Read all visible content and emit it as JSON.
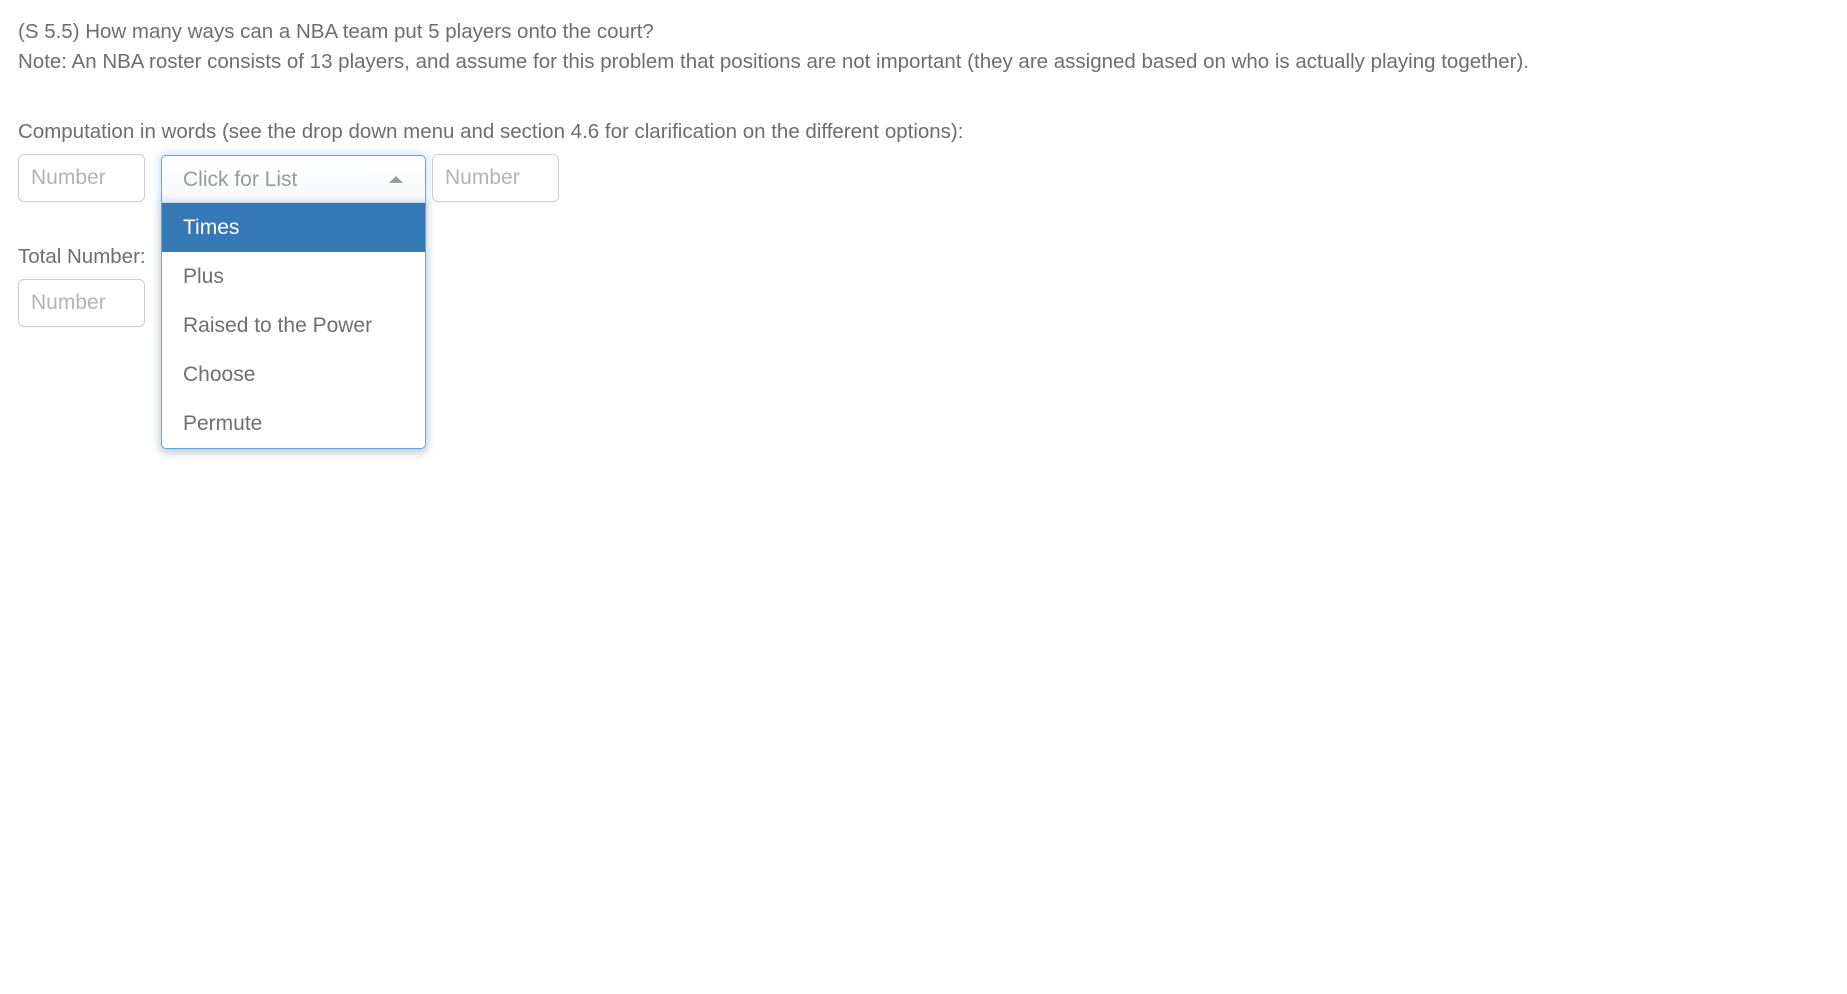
{
  "question": {
    "line1": "(S 5.5) How many ways can a NBA team put 5 players onto the court?",
    "line2": "Note: An NBA roster consists of 13 players, and assume for this problem that positions are not important (they are assigned based on who is actually playing together)."
  },
  "prompt": {
    "text": "Computation in words (see the drop down menu and section 4.6 for clarification on the different options):"
  },
  "inputs": {
    "left": {
      "value": "",
      "placeholder": "Number"
    },
    "right": {
      "value": "",
      "placeholder": "Number"
    },
    "total": {
      "value": "",
      "placeholder": "Number"
    }
  },
  "dropdown": {
    "selected_label": "Click for List",
    "caret_icon": "caret-up-icon",
    "expanded": true,
    "highlighted_index": 0,
    "options": [
      {
        "label": "Times"
      },
      {
        "label": "Plus"
      },
      {
        "label": "Raised to the Power"
      },
      {
        "label": "Choose"
      },
      {
        "label": "Permute"
      }
    ]
  },
  "total_section": {
    "label": "Total Number:"
  },
  "colors": {
    "highlight": "#3579b6",
    "focus_border": "#5ba7e0",
    "text": "#6e6e6e",
    "placeholder": "#b4b4b4",
    "input_border": "#cfcfcf"
  }
}
